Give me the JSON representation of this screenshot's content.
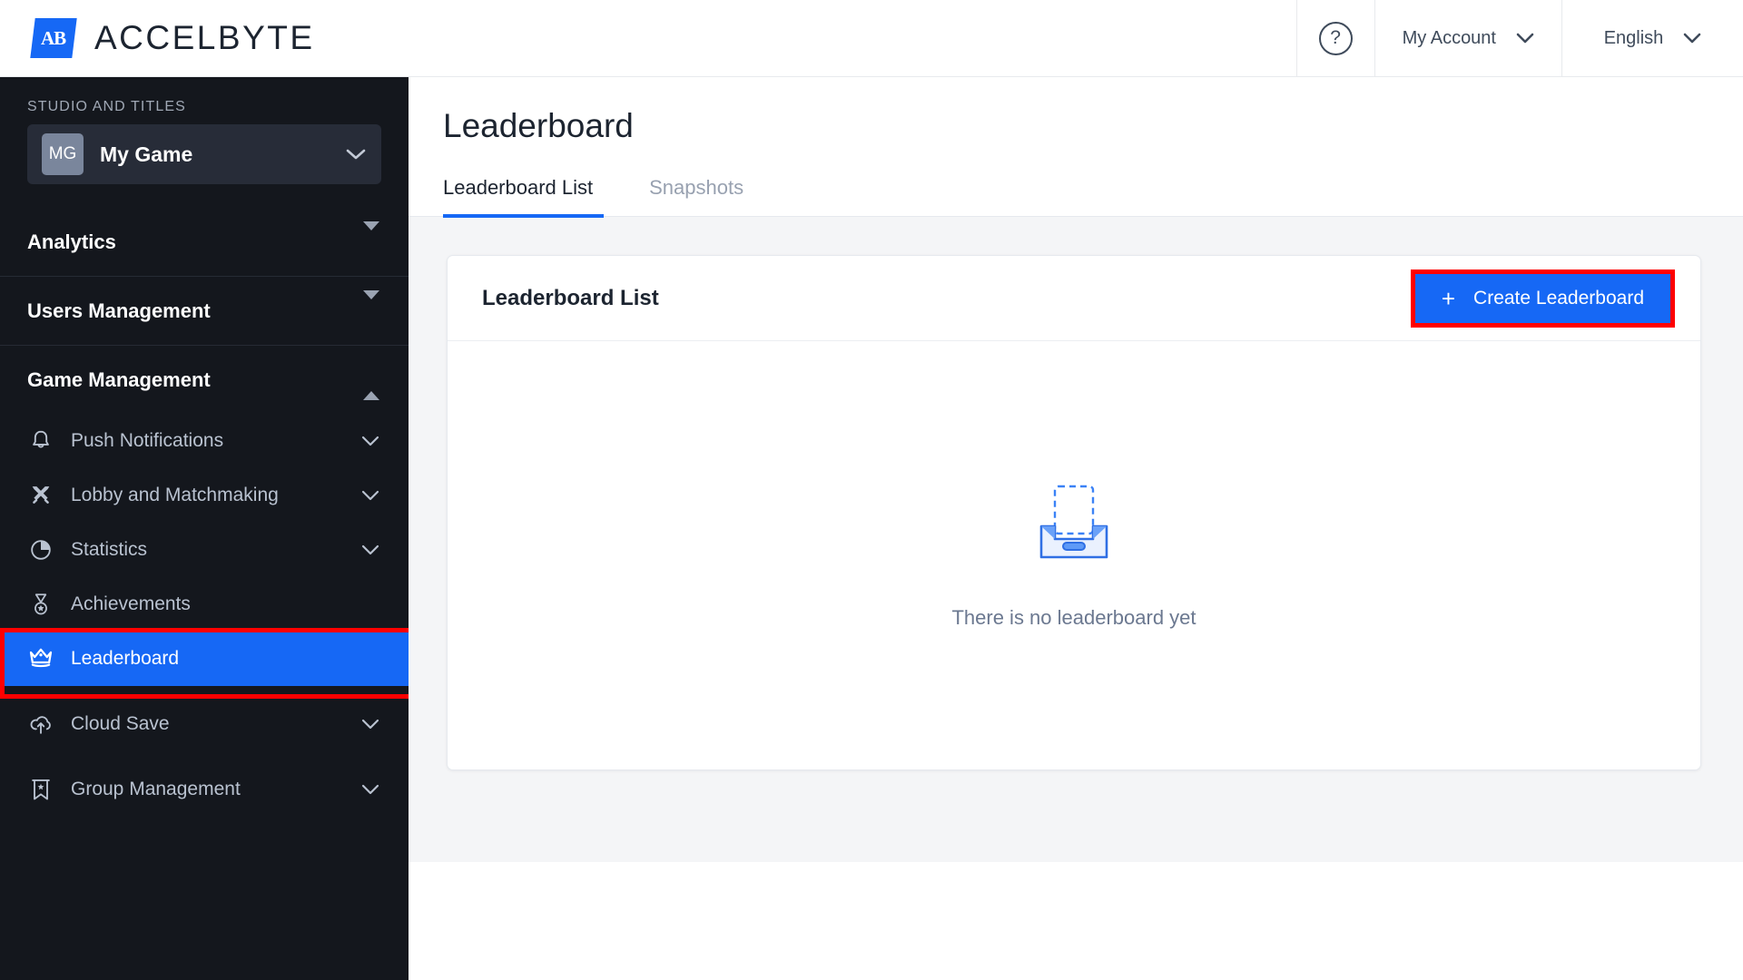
{
  "brand": {
    "mark_text": "AB",
    "name_strong": "ACCEL",
    "name_light": "BYTE",
    "accent": "#1668f5"
  },
  "topbar": {
    "help_icon": "question-circle-icon",
    "help_glyph": "?",
    "account_label": "My Account",
    "language_label": "English"
  },
  "sidebar": {
    "section_label": "STUDIO AND TITLES",
    "game": {
      "initials": "MG",
      "name": "My Game"
    },
    "groups": [
      {
        "label": "Analytics",
        "expanded": false
      },
      {
        "label": "Users Management",
        "expanded": false
      },
      {
        "label": "Game Management",
        "expanded": true
      }
    ],
    "items": [
      {
        "label": "Push Notifications",
        "icon": "bell-icon",
        "has_chevron": true,
        "active": false
      },
      {
        "label": "Lobby and Matchmaking",
        "icon": "crossed-swords-icon",
        "has_chevron": true,
        "active": false
      },
      {
        "label": "Statistics",
        "icon": "pie-chart-icon",
        "has_chevron": true,
        "active": false
      },
      {
        "label": "Achievements",
        "icon": "medal-icon",
        "has_chevron": false,
        "active": false
      },
      {
        "label": "Leaderboard",
        "icon": "crown-icon",
        "has_chevron": false,
        "active": true
      },
      {
        "label": "Cloud Save",
        "icon": "cloud-upload-icon",
        "has_chevron": true,
        "active": false
      },
      {
        "label": "Group Management",
        "icon": "banner-star-icon",
        "has_chevron": true,
        "active": false
      }
    ]
  },
  "main": {
    "page_title": "Leaderboard",
    "tabs": [
      {
        "label": "Leaderboard List",
        "active": true
      },
      {
        "label": "Snapshots",
        "active": false
      }
    ],
    "card": {
      "title": "Leaderboard List",
      "create_button": {
        "label": "Create Leaderboard",
        "plus_glyph": "+",
        "highlighted": true
      },
      "empty_state": {
        "icon": "empty-tray-icon",
        "message": "There is no leaderboard yet"
      }
    }
  },
  "highlight": {
    "color": "#ff0000",
    "targets": [
      "sidebar-item-leaderboard",
      "create-leaderboard-button"
    ]
  }
}
